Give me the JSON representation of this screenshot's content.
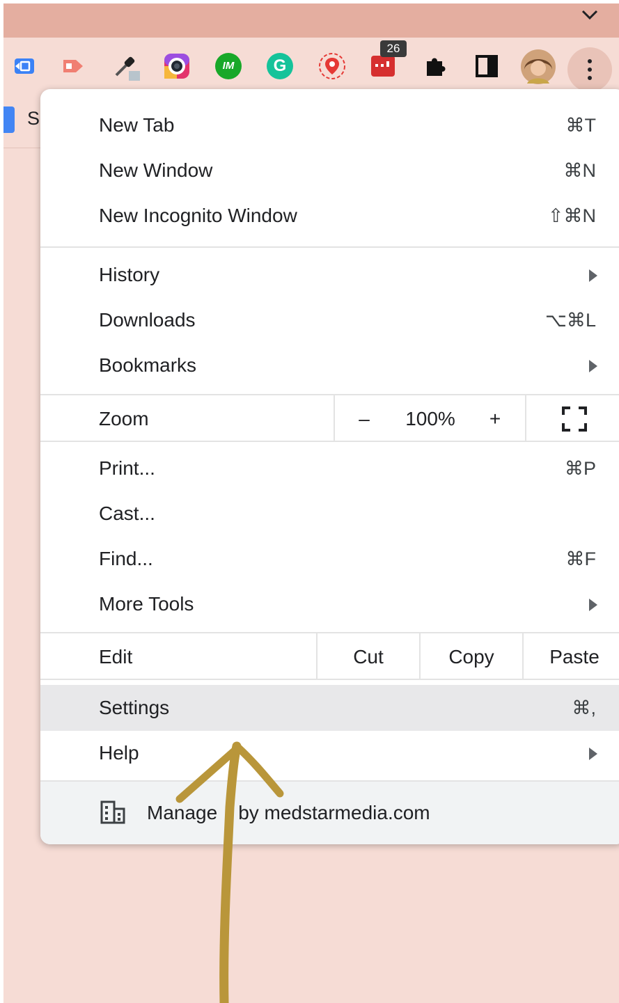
{
  "toolbar": {
    "extensions": [
      {
        "icon": "reader-extension-icon"
      },
      {
        "icon": "screencast-extension-icon"
      },
      {
        "icon": "eyedropper-extension-icon"
      },
      {
        "icon": "camera-lens-extension-icon"
      },
      {
        "icon": "im-extension-icon",
        "text": "IM"
      },
      {
        "icon": "grammarly-icon",
        "text": "G"
      },
      {
        "icon": "location-pin-extension-icon"
      },
      {
        "icon": "calendar-extension-icon"
      },
      {
        "icon": "puzzle-extensions-icon"
      },
      {
        "icon": "side-panel-icon"
      }
    ],
    "badge_count": "26",
    "bookmark_letter": "S"
  },
  "menu": {
    "new_tab": {
      "label": "New Tab",
      "shortcut": "⌘T"
    },
    "new_window": {
      "label": "New Window",
      "shortcut": "⌘N"
    },
    "new_incognito": {
      "label": "New Incognito Window",
      "shortcut": "⇧⌘N"
    },
    "history": {
      "label": "History"
    },
    "downloads": {
      "label": "Downloads",
      "shortcut": "⌥⌘L"
    },
    "bookmarks": {
      "label": "Bookmarks"
    },
    "zoom": {
      "label": "Zoom",
      "minus": "–",
      "value": "100%",
      "plus": "+"
    },
    "print": {
      "label": "Print...",
      "shortcut": "⌘P"
    },
    "cast": {
      "label": "Cast..."
    },
    "find": {
      "label": "Find...",
      "shortcut": "⌘F"
    },
    "more_tools": {
      "label": "More Tools"
    },
    "edit": {
      "label": "Edit",
      "cut": "Cut",
      "copy": "Copy",
      "paste": "Paste"
    },
    "settings": {
      "label": "Settings",
      "shortcut": "⌘,"
    },
    "help": {
      "label": "Help"
    },
    "managed": {
      "label": "Manage",
      "suffix": "by medstarmedia.com"
    }
  },
  "colors": {
    "background": "#f6dcd5",
    "titlebar": "#e4aea0",
    "arrow": "#b9963a",
    "settings_highlight": "#e8e8ea"
  }
}
